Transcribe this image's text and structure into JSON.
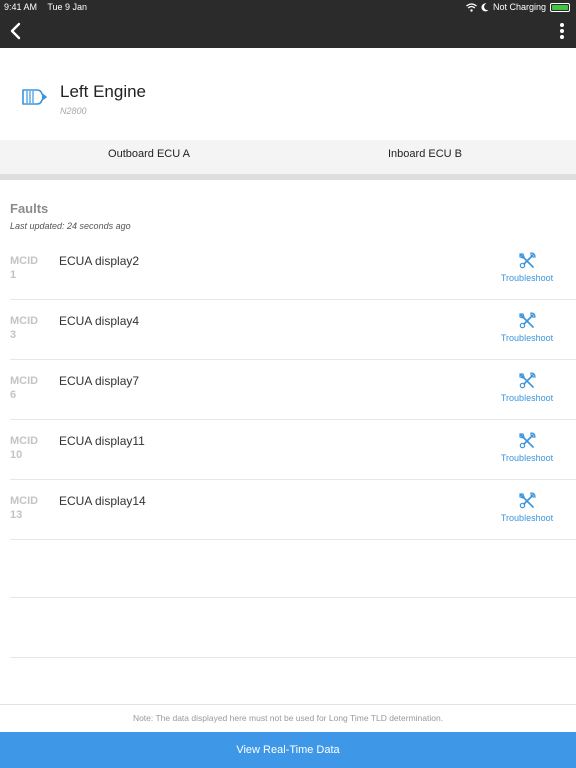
{
  "status_bar": {
    "time": "9:41 AM",
    "date": "Tue 9 Jan",
    "charging": "Not Charging",
    "icons": [
      "wifi-icon",
      "moon-icon",
      "battery-icon"
    ],
    "battery_color": "#43c443"
  },
  "nav": {
    "back_icon": "chevron-left-icon",
    "more_icon": "vertical-ellipsis-icon"
  },
  "engine": {
    "title": "Left Engine",
    "subtitle": "N2800",
    "icon": "engine-icon"
  },
  "tabs": [
    {
      "label": "Outboard ECU A"
    },
    {
      "label": "Inboard ECU B"
    }
  ],
  "faults": {
    "title": "Faults",
    "last_updated": "Last updated: 24 seconds ago",
    "rows": [
      {
        "mcid_label": "MCID",
        "mcid": "1",
        "display": "ECUA display2",
        "action": "Troubleshoot"
      },
      {
        "mcid_label": "MCID",
        "mcid": "3",
        "display": "ECUA display4",
        "action": "Troubleshoot"
      },
      {
        "mcid_label": "MCID",
        "mcid": "6",
        "display": "ECUA display7",
        "action": "Troubleshoot"
      },
      {
        "mcid_label": "MCID",
        "mcid": "10",
        "display": "ECUA display11",
        "action": "Troubleshoot"
      },
      {
        "mcid_label": "MCID",
        "mcid": "13",
        "display": "ECUA display14",
        "action": "Troubleshoot"
      }
    ]
  },
  "note": "Note: The data displayed here must not be used for Long Time TLD determination.",
  "bottom_button": "View Real-Time Data",
  "colors": {
    "accent": "#3f97e8",
    "link": "#3a95dd",
    "nav_bg": "#2b2b2b"
  }
}
